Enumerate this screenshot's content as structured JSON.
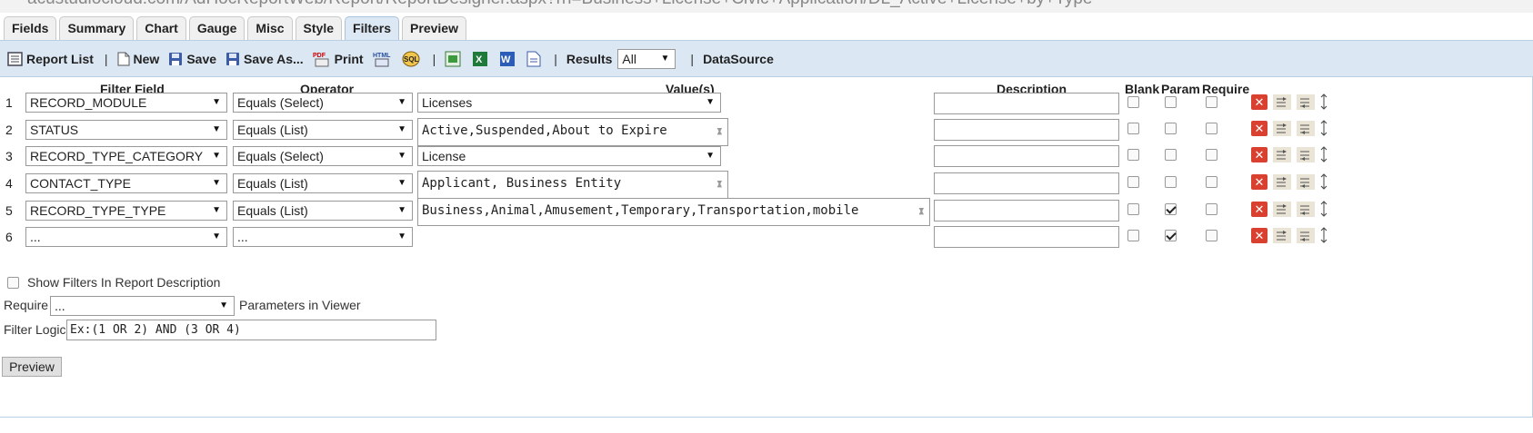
{
  "breadcrumb": "acustudiocloud.com/AdHocReportWeb/Report/ReportDesigner.aspx?rn=Business+License+Civic+Application/DL_Active+License+by+Type",
  "tabs": [
    "Fields",
    "Summary",
    "Chart",
    "Gauge",
    "Misc",
    "Style",
    "Filters",
    "Preview"
  ],
  "active_tab": "Filters",
  "toolbar": {
    "report_list": "Report List",
    "new": "New",
    "save": "Save",
    "save_as": "Save As...",
    "print": "Print",
    "results_label": "Results",
    "results_value": "All",
    "datasource": "DataSource",
    "separator": "|"
  },
  "headers": {
    "filter_field": "Filter Field",
    "operator": "Operator",
    "values": "Value(s)",
    "description": "Description",
    "blank": "Blank",
    "param": "Param",
    "require": "Require"
  },
  "rows": [
    {
      "num": "1",
      "field": "RECORD_MODULE",
      "operator": "Equals (Select)",
      "value": "Licenses",
      "description": "",
      "blank": false,
      "param": false,
      "require": false
    },
    {
      "num": "2",
      "field": "STATUS",
      "operator": "Equals (List)",
      "value": "Active,Suspended,About to Expire",
      "description": "",
      "blank": false,
      "param": false,
      "require": false
    },
    {
      "num": "3",
      "field": "RECORD_TYPE_CATEGORY",
      "operator": "Equals (Select)",
      "value": "License",
      "description": "",
      "blank": false,
      "param": false,
      "require": false
    },
    {
      "num": "4",
      "field": "CONTACT_TYPE",
      "operator": "Equals (List)",
      "value": "Applicant, Business Entity",
      "description": "",
      "blank": false,
      "param": false,
      "require": false
    },
    {
      "num": "5",
      "field": "RECORD_TYPE_TYPE",
      "operator": "Equals (List)",
      "value": "Business,Animal,Amusement,Temporary,Transportation,mobile",
      "description": "",
      "blank": false,
      "param": true,
      "require": false
    },
    {
      "num": "6",
      "field": "...",
      "operator": "...",
      "value": "",
      "description": "",
      "blank": false,
      "param": true,
      "require": false
    }
  ],
  "show_filters_label": "Show Filters In Report Description",
  "require_label": "Require",
  "require_value": "...",
  "params_in_viewer": "Parameters in Viewer",
  "filter_logic_label": "Filter Logic",
  "filter_logic_value": "Ex:(1 OR 2) AND (3 OR 4)",
  "preview_button": "Preview"
}
